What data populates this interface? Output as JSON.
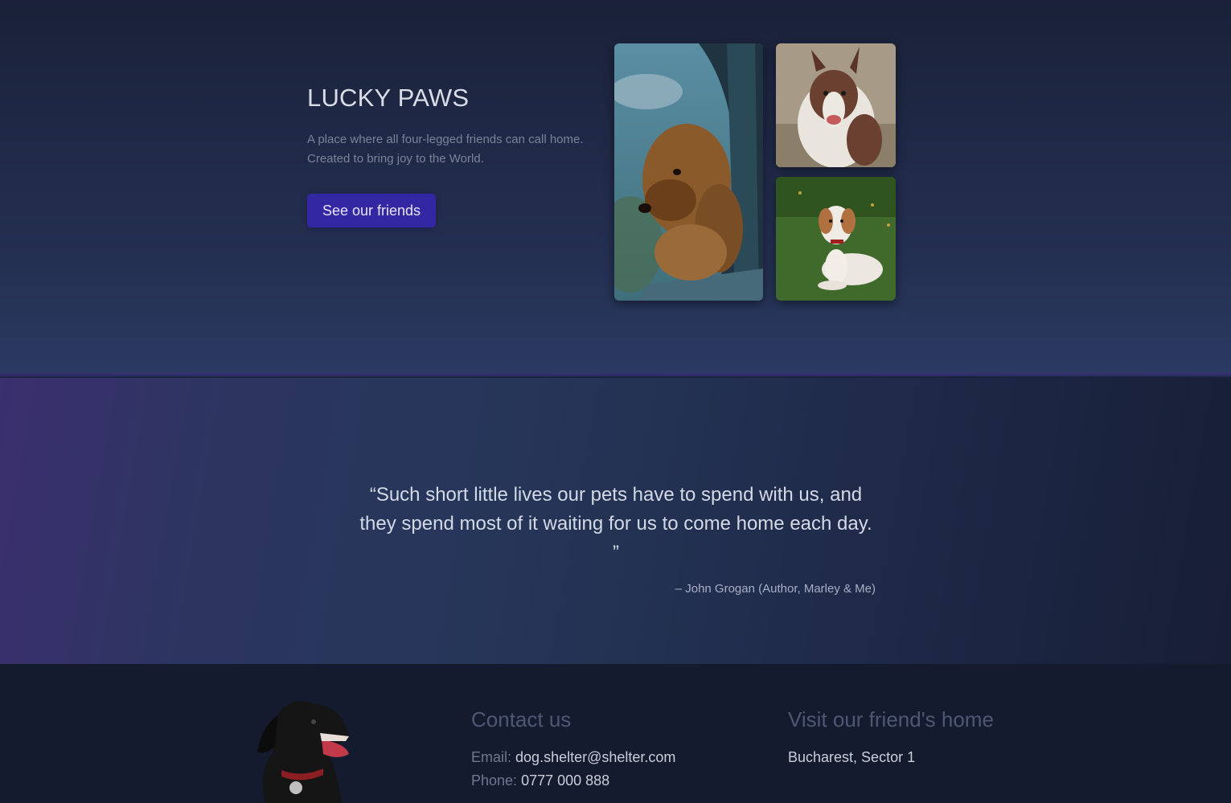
{
  "hero": {
    "title": "LUCKY PAWS",
    "tagline_line1": "A place where all four-legged friends can call home.",
    "tagline_line2": "Created to bring joy to the World.",
    "cta_label": "See our friends",
    "photos": [
      "dog-in-car-window-photo",
      "collie-dog-photo",
      "puppy-on-grass-photo"
    ]
  },
  "quote": {
    "text_line1": "“Such short little lives our pets have to spend with us, and",
    "text_line2": "they spend most of it waiting for us to come home each day.",
    "text_line3": "”",
    "author": "– John Grogan (Author, Marley & Me)"
  },
  "footer": {
    "contact_heading": "Contact us",
    "email_label": "Email:",
    "email_value": "dog.shelter@shelter.com",
    "phone_label": "Phone:",
    "phone_value": "0777 000 888",
    "visit_heading": "Visit our friend's home",
    "address": "Bucharest, Sector 1"
  },
  "colors": {
    "accent": "#3427a3",
    "hero_bg": "#243052",
    "footer_bg": "#141b2e"
  }
}
